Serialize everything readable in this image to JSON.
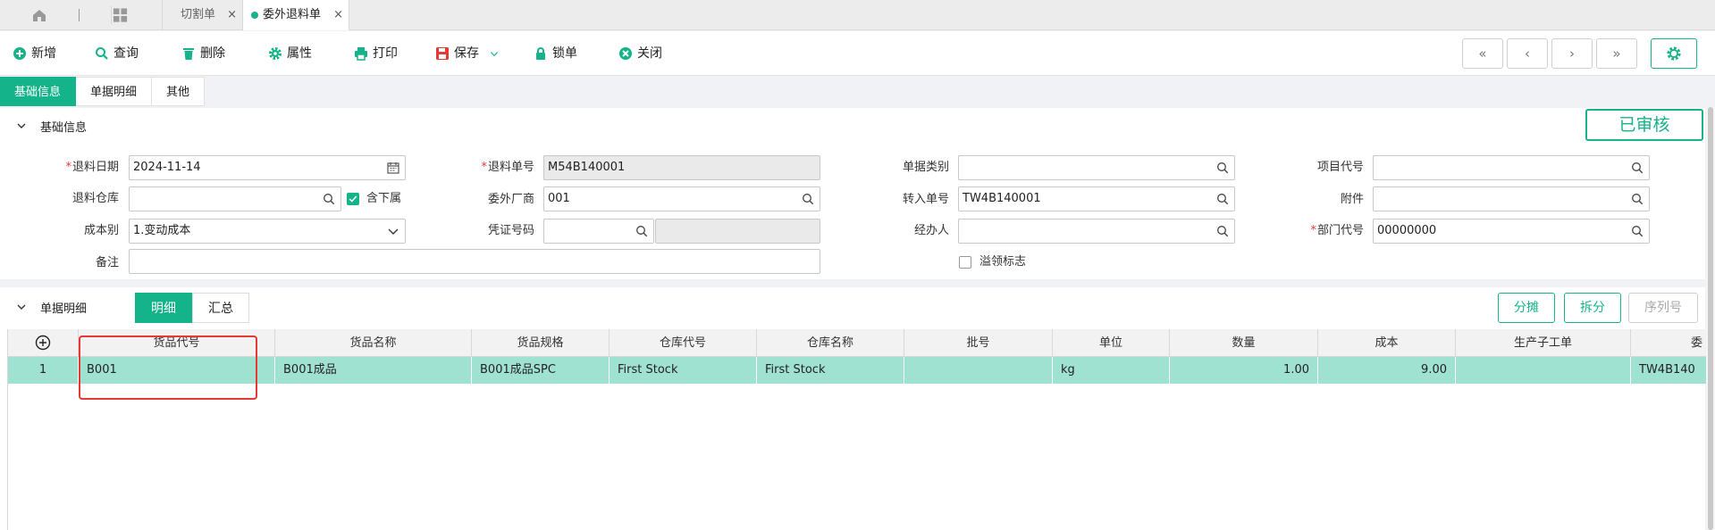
{
  "topbar": {
    "tabs": [
      {
        "label": "切割单",
        "close": "×"
      },
      {
        "label": "委外退料单",
        "close": "×"
      }
    ]
  },
  "toolbar": {
    "new": "新增",
    "query": "查询",
    "delete": "删除",
    "attributes": "属性",
    "print": "打印",
    "save": "保存",
    "lock": "锁单",
    "close": "关闭",
    "nav": [
      "«",
      "‹",
      "›",
      "»"
    ]
  },
  "section_tabs": [
    "基础信息",
    "单据明细",
    "其他"
  ],
  "basic": {
    "title": "基础信息",
    "status": "已审核",
    "fields": {
      "return_date": {
        "label": "退料日期",
        "value": "2024-11-14"
      },
      "return_no": {
        "label": "退料单号",
        "value": "M54B140001"
      },
      "doc_category": {
        "label": "单据类别",
        "value": ""
      },
      "project_code": {
        "label": "项目代号",
        "value": ""
      },
      "return_warehouse": {
        "label": "退料仓库",
        "value": ""
      },
      "include_sub": {
        "label": "含下属",
        "checked": true
      },
      "subcontractor": {
        "label": "委外厂商",
        "value": "001"
      },
      "transfer_no": {
        "label": "转入单号",
        "value": "TW4B140001"
      },
      "attachment": {
        "label": "附件",
        "value": ""
      },
      "cost_type": {
        "label": "成本别",
        "value": "1.变动成本"
      },
      "voucher_no": {
        "label": "凭证号码",
        "value": ""
      },
      "handler": {
        "label": "经办人",
        "value": ""
      },
      "dept_code": {
        "label": "部门代号",
        "value": "00000000"
      },
      "remark": {
        "label": "备注",
        "value": ""
      },
      "overflow_flag": {
        "label": "溢领标志",
        "checked": false
      }
    }
  },
  "detail": {
    "title": "单据明细",
    "subtabs": [
      "明细",
      "汇总"
    ],
    "buttons": {
      "split_alloc": "分摊",
      "split": "拆分",
      "serial": "序列号"
    },
    "columns": [
      "货品代号",
      "货品名称",
      "货品规格",
      "仓库代号",
      "仓库名称",
      "批号",
      "单位",
      "数量",
      "成本",
      "生产子工单",
      "委"
    ],
    "rows": [
      {
        "index": "1",
        "cells": [
          "B001",
          "B001成品",
          "B001成品SPC",
          "First Stock",
          "First Stock",
          "",
          "kg",
          "1.00",
          "9.00",
          "",
          "TW4B140"
        ]
      }
    ]
  },
  "colors": {
    "accent": "#14b38a",
    "row_highlight": "#a0e2d2",
    "required": "#e53935"
  }
}
